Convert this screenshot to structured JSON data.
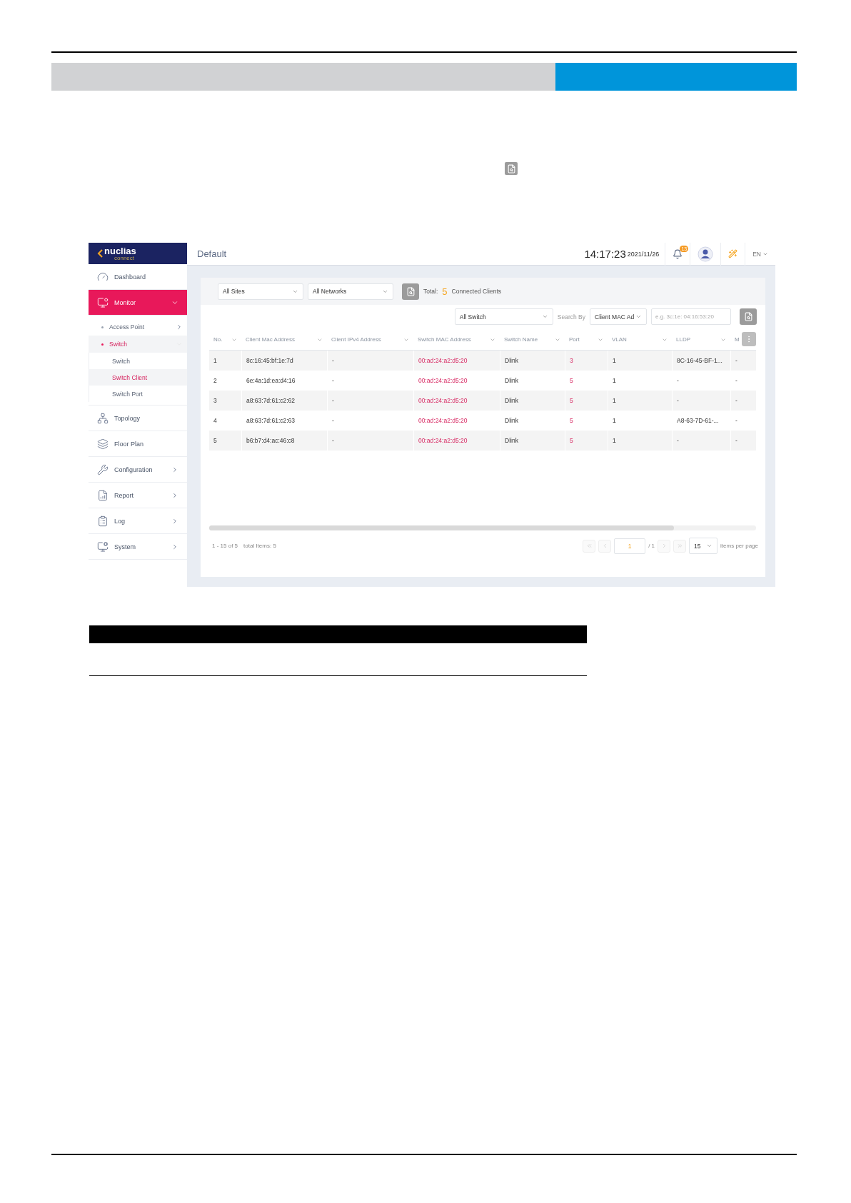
{
  "app": {
    "logo": {
      "name": "nuclias",
      "tagline": "connect"
    },
    "sidebar": {
      "items": [
        {
          "label": "Dashboard",
          "selected": false
        },
        {
          "label": "Monitor",
          "selected": true,
          "expanded": true,
          "children": [
            {
              "label": "Access Point",
              "selected": false,
              "expanded": false
            },
            {
              "label": "Switch",
              "selected": true,
              "expanded": true,
              "children": [
                {
                  "label": "Switch",
                  "selected": false
                },
                {
                  "label": "Switch Client",
                  "selected": true
                },
                {
                  "label": "Switch Port",
                  "selected": false
                }
              ]
            }
          ]
        },
        {
          "label": "Topology",
          "selected": false
        },
        {
          "label": "Floor Plan",
          "selected": false
        },
        {
          "label": "Configuration",
          "selected": false,
          "expanded": false
        },
        {
          "label": "Report",
          "selected": false,
          "expanded": false
        },
        {
          "label": "Log",
          "selected": false,
          "expanded": false
        },
        {
          "label": "System",
          "selected": false,
          "expanded": false
        }
      ]
    },
    "topbar": {
      "title": "Default",
      "time": "14:17:23",
      "date": "2021/11/26",
      "notifications": "13",
      "language": "EN"
    },
    "filters": {
      "site": "All Sites",
      "network": "All Networks",
      "total_label": "Total:",
      "total_count": "5",
      "total_suffix": "Connected Clients"
    },
    "search": {
      "switch": "All Switch",
      "search_by_label": "Search By",
      "search_by": "Client MAC Ad",
      "placeholder": "e.g. 3c:1e: 04:16:53:20"
    },
    "table": {
      "columns": [
        {
          "label": "No.",
          "kind": "text"
        },
        {
          "label": "Client Mac Address",
          "kind": "text"
        },
        {
          "label": "Client IPv4 Address",
          "kind": "text"
        },
        {
          "label": "Switch MAC Address",
          "kind": "link"
        },
        {
          "label": "Switch Name",
          "kind": "text"
        },
        {
          "label": "Port",
          "kind": "link"
        },
        {
          "label": "VLAN",
          "kind": "text"
        },
        {
          "label": "LLDP",
          "kind": "text"
        },
        {
          "label": "M",
          "kind": "text"
        }
      ],
      "rows": [
        [
          "1",
          "8c:16:45:bf:1e:7d",
          "-",
          "00:ad:24:a2:d5:20",
          "Dlink",
          "3",
          "1",
          "8C-16-45-BF-1...",
          "-"
        ],
        [
          "2",
          "6e:4a:1d:ea:d4:16",
          "-",
          "00:ad:24:a2:d5:20",
          "Dlink",
          "5",
          "1",
          "-",
          "-"
        ],
        [
          "3",
          "a8:63:7d:61:c2:62",
          "-",
          "00:ad:24:a2:d5:20",
          "Dlink",
          "5",
          "1",
          "-",
          "-"
        ],
        [
          "4",
          "a8:63:7d:61:c2:63",
          "-",
          "00:ad:24:a2:d5:20",
          "Dlink",
          "5",
          "1",
          "A8-63-7D-61-...",
          "-"
        ],
        [
          "5",
          "b6:b7:d4:ac:46:c8",
          "-",
          "00:ad:24:a2:d5:20",
          "Dlink",
          "5",
          "1",
          "-",
          "-"
        ]
      ]
    },
    "footer": {
      "range": "1 - 15 of 5",
      "total": "total Items: 5",
      "page": "1",
      "page_count": "/ 1",
      "page_size": "15",
      "page_size_label": "items per page"
    }
  }
}
